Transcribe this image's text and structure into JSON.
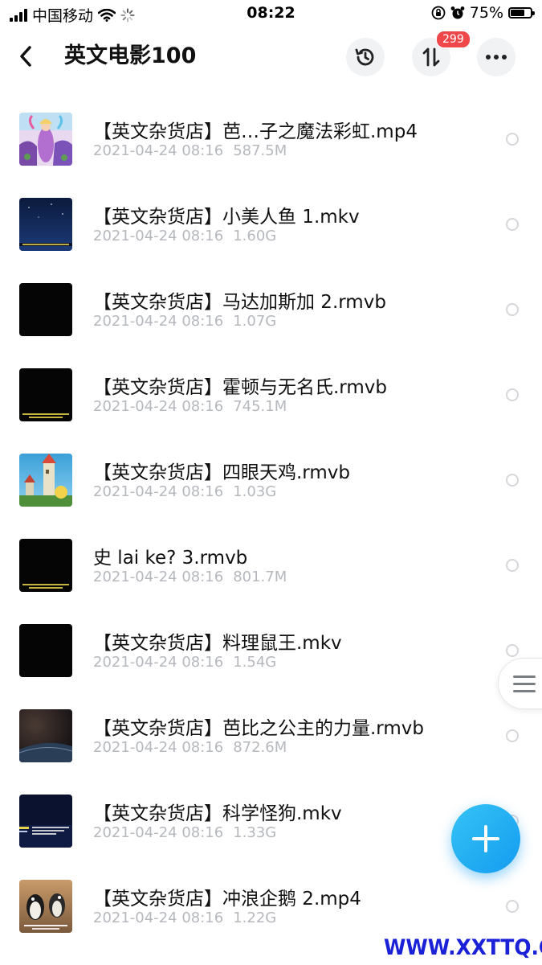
{
  "status_bar": {
    "carrier": "中国移动",
    "time": "08:22",
    "battery_percent": "75%",
    "battery_level": 0.75
  },
  "header": {
    "title": "英文电影100",
    "transfer_badge": "299",
    "icons": [
      "back-icon",
      "history-icon",
      "transfer-icon",
      "more-icon"
    ]
  },
  "files": [
    {
      "name": "【英文杂货店】芭…子之魔法彩虹.mp4",
      "date": "2021-04-24 08:16",
      "size": "587.5M",
      "thumb": "barbie-rainbow"
    },
    {
      "name": "【英文杂货店】小美人鱼 1.mkv",
      "date": "2021-04-24 08:16",
      "size": "1.60G",
      "thumb": "mermaid-night"
    },
    {
      "name": "【英文杂货店】马达加斯加 2.rmvb",
      "date": "2021-04-24 08:16",
      "size": "1.07G",
      "thumb": "black"
    },
    {
      "name": "【英文杂货店】霍顿与无名氏.rmvb",
      "date": "2021-04-24 08:16",
      "size": "745.1M",
      "thumb": "black-caption"
    },
    {
      "name": "【英文杂货店】四眼天鸡.rmvb",
      "date": "2021-04-24 08:16",
      "size": "1.03G",
      "thumb": "chicken-little"
    },
    {
      "name": "史 lai ke?  3.rmvb",
      "date": "2021-04-24 08:16",
      "size": "801.7M",
      "thumb": "black-caption"
    },
    {
      "name": "【英文杂货店】料理鼠王.mkv",
      "date": "2021-04-24 08:16",
      "size": "1.54G",
      "thumb": "black"
    },
    {
      "name": "【英文杂货店】芭比之公主的力量.rmvb",
      "date": "2021-04-24 08:16",
      "size": "872.6M",
      "thumb": "dark-sky"
    },
    {
      "name": "【英文杂货店】科学怪狗.mkv",
      "date": "2021-04-24 08:16",
      "size": "1.33G",
      "thumb": "frankenweenie"
    },
    {
      "name": "【英文杂货店】冲浪企鹅 2.mp4",
      "date": "2021-04-24 08:16",
      "size": "1.22G",
      "thumb": "penguins"
    }
  ],
  "floating": {
    "add_button": "plus-icon",
    "side_menu": "menu-lines-icon"
  },
  "watermark": "WWW.XXTTQ.COM",
  "colors": {
    "accent": "#149cf0",
    "badge": "#f0474a",
    "watermark": "#1a21d6",
    "meta_text": "#b5b8bd"
  }
}
